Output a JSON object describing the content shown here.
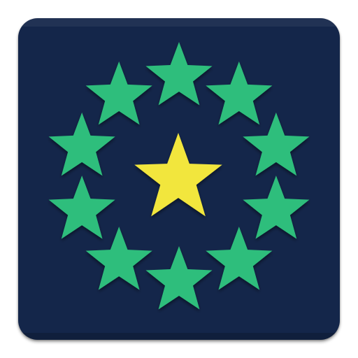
{
  "icon": {
    "name": "app-icon",
    "background_color": "#14264a",
    "ring_star_color": "#2fbe7c",
    "center_star_color": "#f2e63d",
    "ring_star_count": 10
  }
}
